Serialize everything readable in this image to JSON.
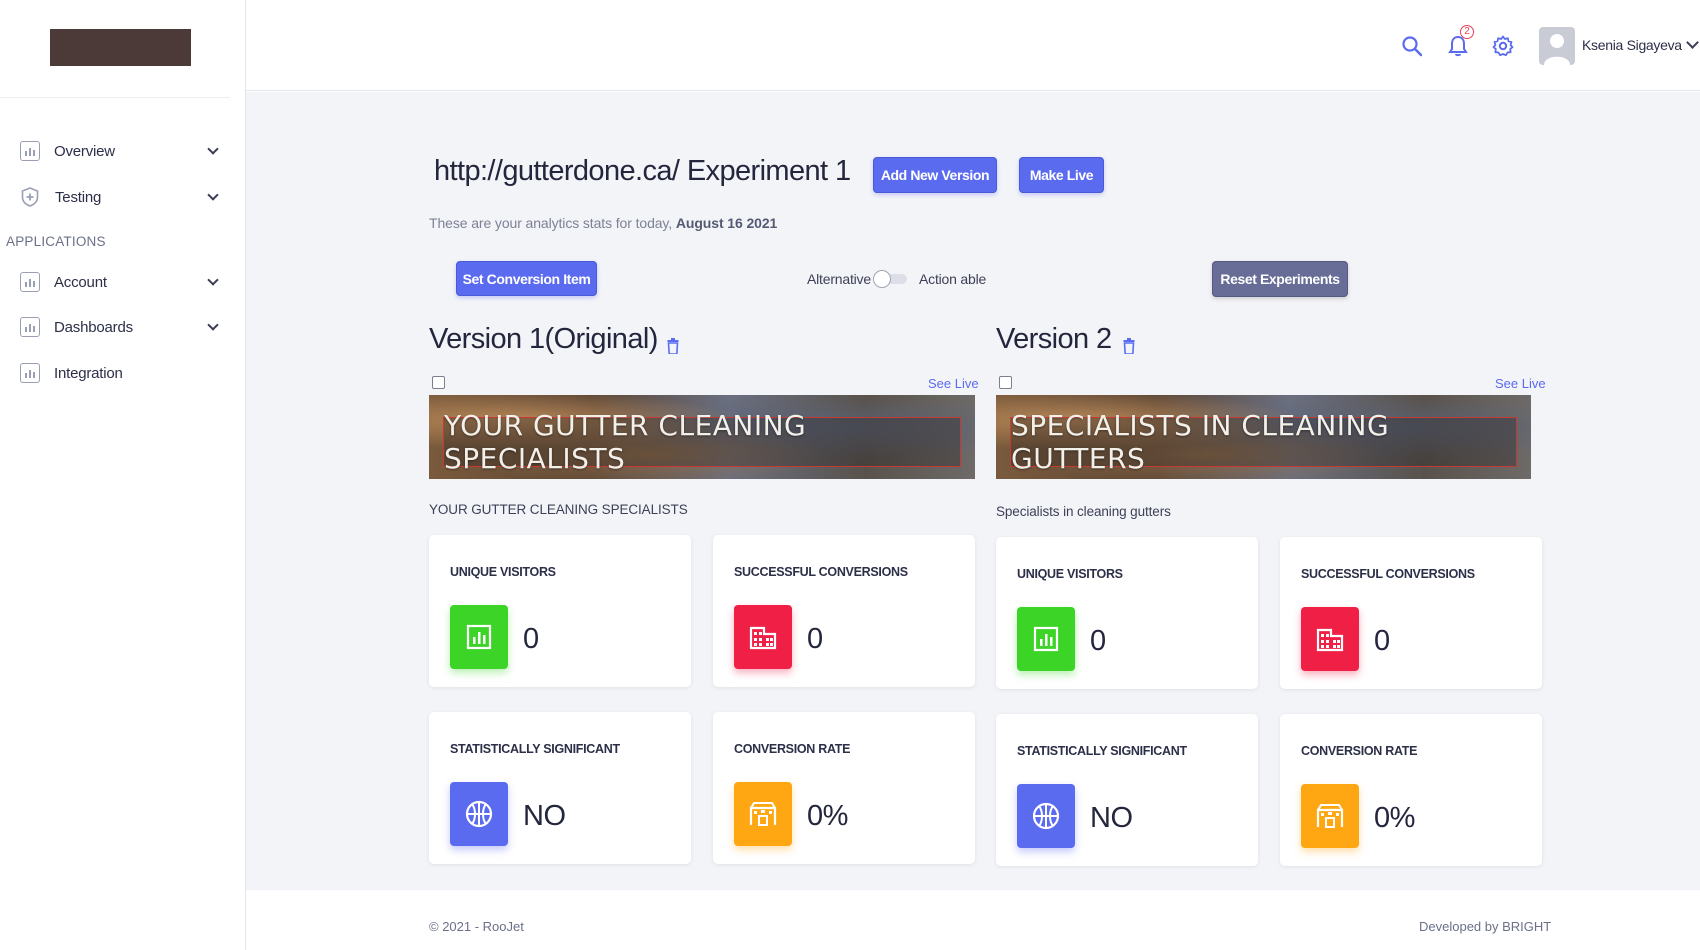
{
  "header": {
    "notification_count": "2",
    "user_name": "Ksenia Sigayeva"
  },
  "sidebar": {
    "section_label": "APPLICATIONS",
    "items": [
      {
        "label": "Overview",
        "icon": "chart-icon"
      },
      {
        "label": "Testing",
        "icon": "shield-icon"
      },
      {
        "label": "Account",
        "icon": "chart-icon"
      },
      {
        "label": "Dashboards",
        "icon": "chart-icon"
      },
      {
        "label": "Integration",
        "icon": "chart-icon"
      }
    ]
  },
  "main": {
    "title": "http://gutterdone.ca/ Experiment 1",
    "add_version_label": "Add New Version",
    "make_live_label": "Make Live",
    "subtitle_prefix": "These are your analytics stats for today, ",
    "subtitle_date": "August 16 2021",
    "set_conversion_label": "Set Conversion Item",
    "toggle_left_label": "Alternative",
    "toggle_right_label": "Action able",
    "reset_label": "Reset Experiments",
    "see_live_label": "See Live"
  },
  "versions": [
    {
      "title": "Version 1(Original)",
      "banner_text": "YOUR GUTTER CLEANING SPECIALISTS",
      "caption": "YOUR GUTTER CLEANING SPECIALISTS",
      "stats": {
        "unique_visitors_label": "UNIQUE VISITORS",
        "unique_visitors": "0",
        "conversions_label": "SUCCESSFUL CONVERSIONS",
        "conversions": "0",
        "significant_label": "STATISTICALLY SIGNIFICANT",
        "significant": "NO",
        "rate_label": "CONVERSION RATE",
        "rate": "0%"
      }
    },
    {
      "title": "Version 2",
      "banner_text": "SPECIALISTS IN CLEANING GUTTERS",
      "caption": "Specialists in cleaning gutters",
      "stats": {
        "unique_visitors_label": "UNIQUE VISITORS",
        "unique_visitors": "0",
        "conversions_label": "SUCCESSFUL CONVERSIONS",
        "conversions": "0",
        "significant_label": "STATISTICALLY SIGNIFICANT",
        "significant": "NO",
        "rate_label": "CONVERSION RATE",
        "rate": "0%"
      }
    }
  ],
  "footer": {
    "copyright": "© 2021 - RooJet",
    "credit": "Developed by BRIGHT"
  },
  "colors": {
    "accent": "#5b6bf0",
    "green": "#3dd428",
    "red": "#ef1f45",
    "orange": "#ffa613",
    "reset_button": "#676d96"
  }
}
